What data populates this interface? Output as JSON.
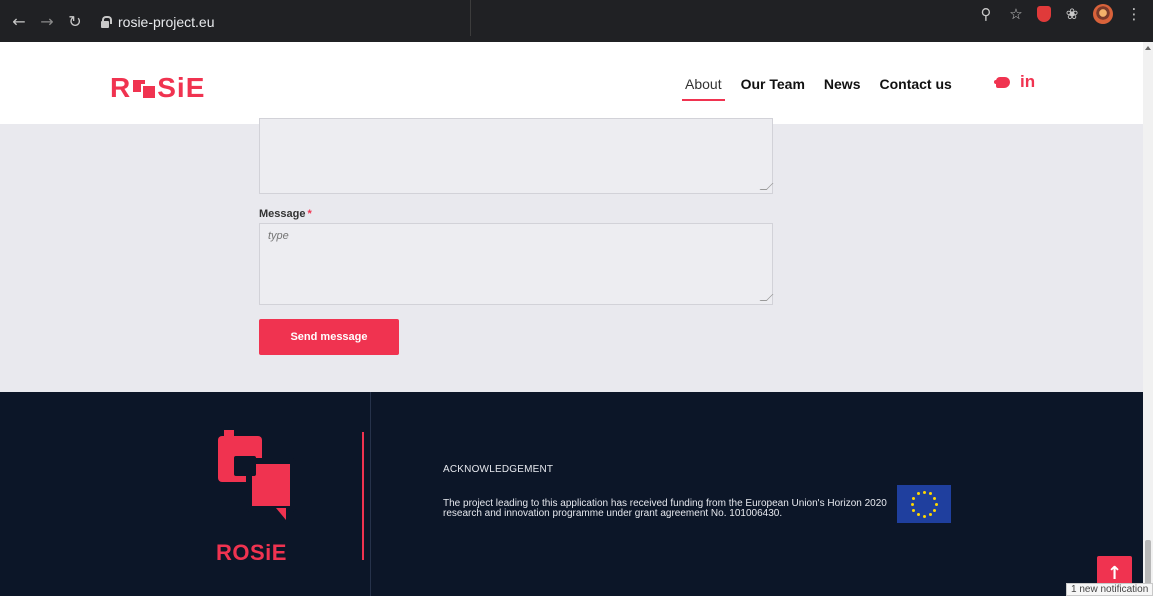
{
  "browser": {
    "url": "rosie-project.eu"
  },
  "header": {
    "logo": "R■SiE",
    "nav": [
      "About",
      "Our Team",
      "News",
      "Contact us"
    ],
    "social": {
      "linkedin_label": "in"
    }
  },
  "form": {
    "message_label": "Message",
    "required_mark": "*",
    "message_placeholder": "type",
    "send_label": "Send message"
  },
  "footer": {
    "brand": "ROSiE",
    "ack_title": "ACKNOWLEDGEMENT",
    "ack_text": "The project leading to this application has received funding from the European Union's Horizon 2020 research and innovation programme under grant agreement No. 101006430."
  },
  "notification": "1 new notification",
  "colors": {
    "accent": "#f03350",
    "footer_bg": "#0c1628",
    "page_bg": "#e9e9ee"
  }
}
